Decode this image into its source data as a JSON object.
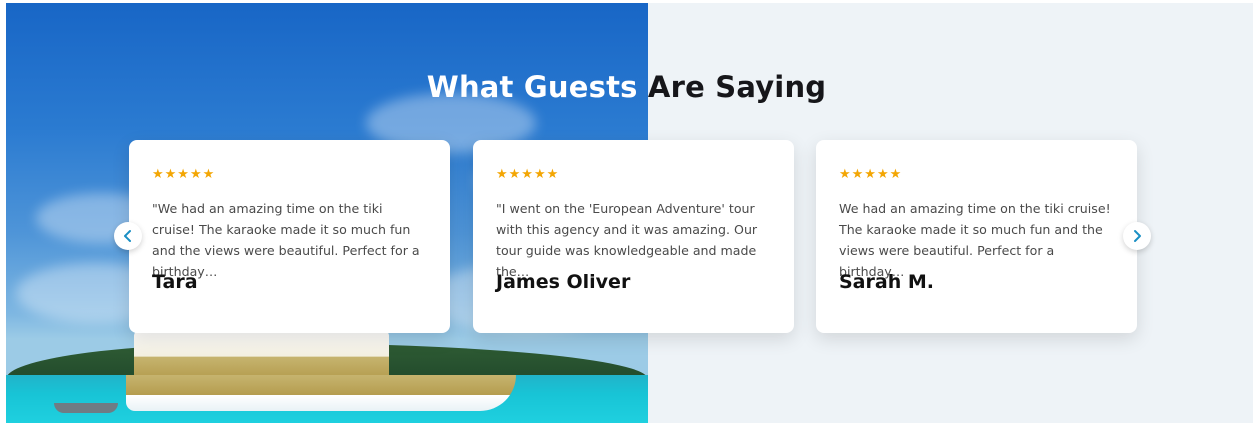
{
  "section": {
    "title_part1": "What Guests",
    "title_part2": "Are Saying"
  },
  "testimonials": [
    {
      "stars": "★★★★★",
      "text": "\"We had an amazing time on the tiki cruise! The karaoke made it so much fun and the views were beautiful. Perfect for a birthday…",
      "author": "Tara"
    },
    {
      "stars": "★★★★★",
      "text": "\"I went on the 'European Adventure' tour with this agency and it was amazing. Our tour guide was knowledgeable and made the…",
      "author": "James Oliver"
    },
    {
      "stars": "★★★★★",
      "text": "We had an amazing time on the tiki cruise! The karaoke made it so much fun and the views were beautiful. Perfect for a birthday…",
      "author": "Sarah M."
    }
  ],
  "navigation": {
    "prev_icon": "chevron-left-icon",
    "next_icon": "chevron-right-icon"
  },
  "colors": {
    "star": "#f3a604",
    "arrow": "#1a8fc4",
    "panel_light": "#eef3f7",
    "title_dark": "#16161a"
  }
}
